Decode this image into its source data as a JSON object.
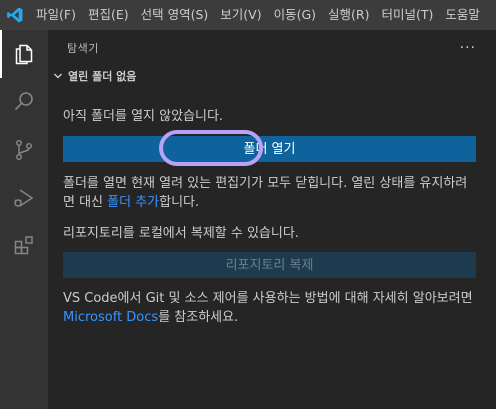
{
  "menubar": {
    "items": [
      "파일(F)",
      "편집(E)",
      "선택 영역(S)",
      "보기(V)",
      "이동(G)",
      "실행(R)",
      "터미널(T)",
      "도움말"
    ]
  },
  "sidebar": {
    "title": "탐색기",
    "more": "···",
    "section_title": "열린 폴더 없음",
    "text_no_folder": "아직 폴더를 열지 않았습니다.",
    "open_folder_button": "폴더 열기",
    "text_close_editors_1": "폴더를 열면 현재 열려 있는 편집기가 모두 닫힙니다. 열린 상태를 유지하려면 대신 ",
    "add_folder_link": "폴더 추가",
    "text_close_editors_2": "합니다.",
    "text_clone": "리포지토리를 로컬에서 복제할 수 있습니다.",
    "clone_button": "리포지토리 복제",
    "text_git_1": "VS Code에서 Git 및 소스 제어를 사용하는 방법에 대해 자세히 알아보려면 ",
    "docs_link": "Microsoft Docs",
    "text_git_2": "를 참조하세요."
  },
  "colors": {
    "accent": "#0e639c",
    "link": "#3794ff",
    "highlight": "#b9a2f5"
  }
}
